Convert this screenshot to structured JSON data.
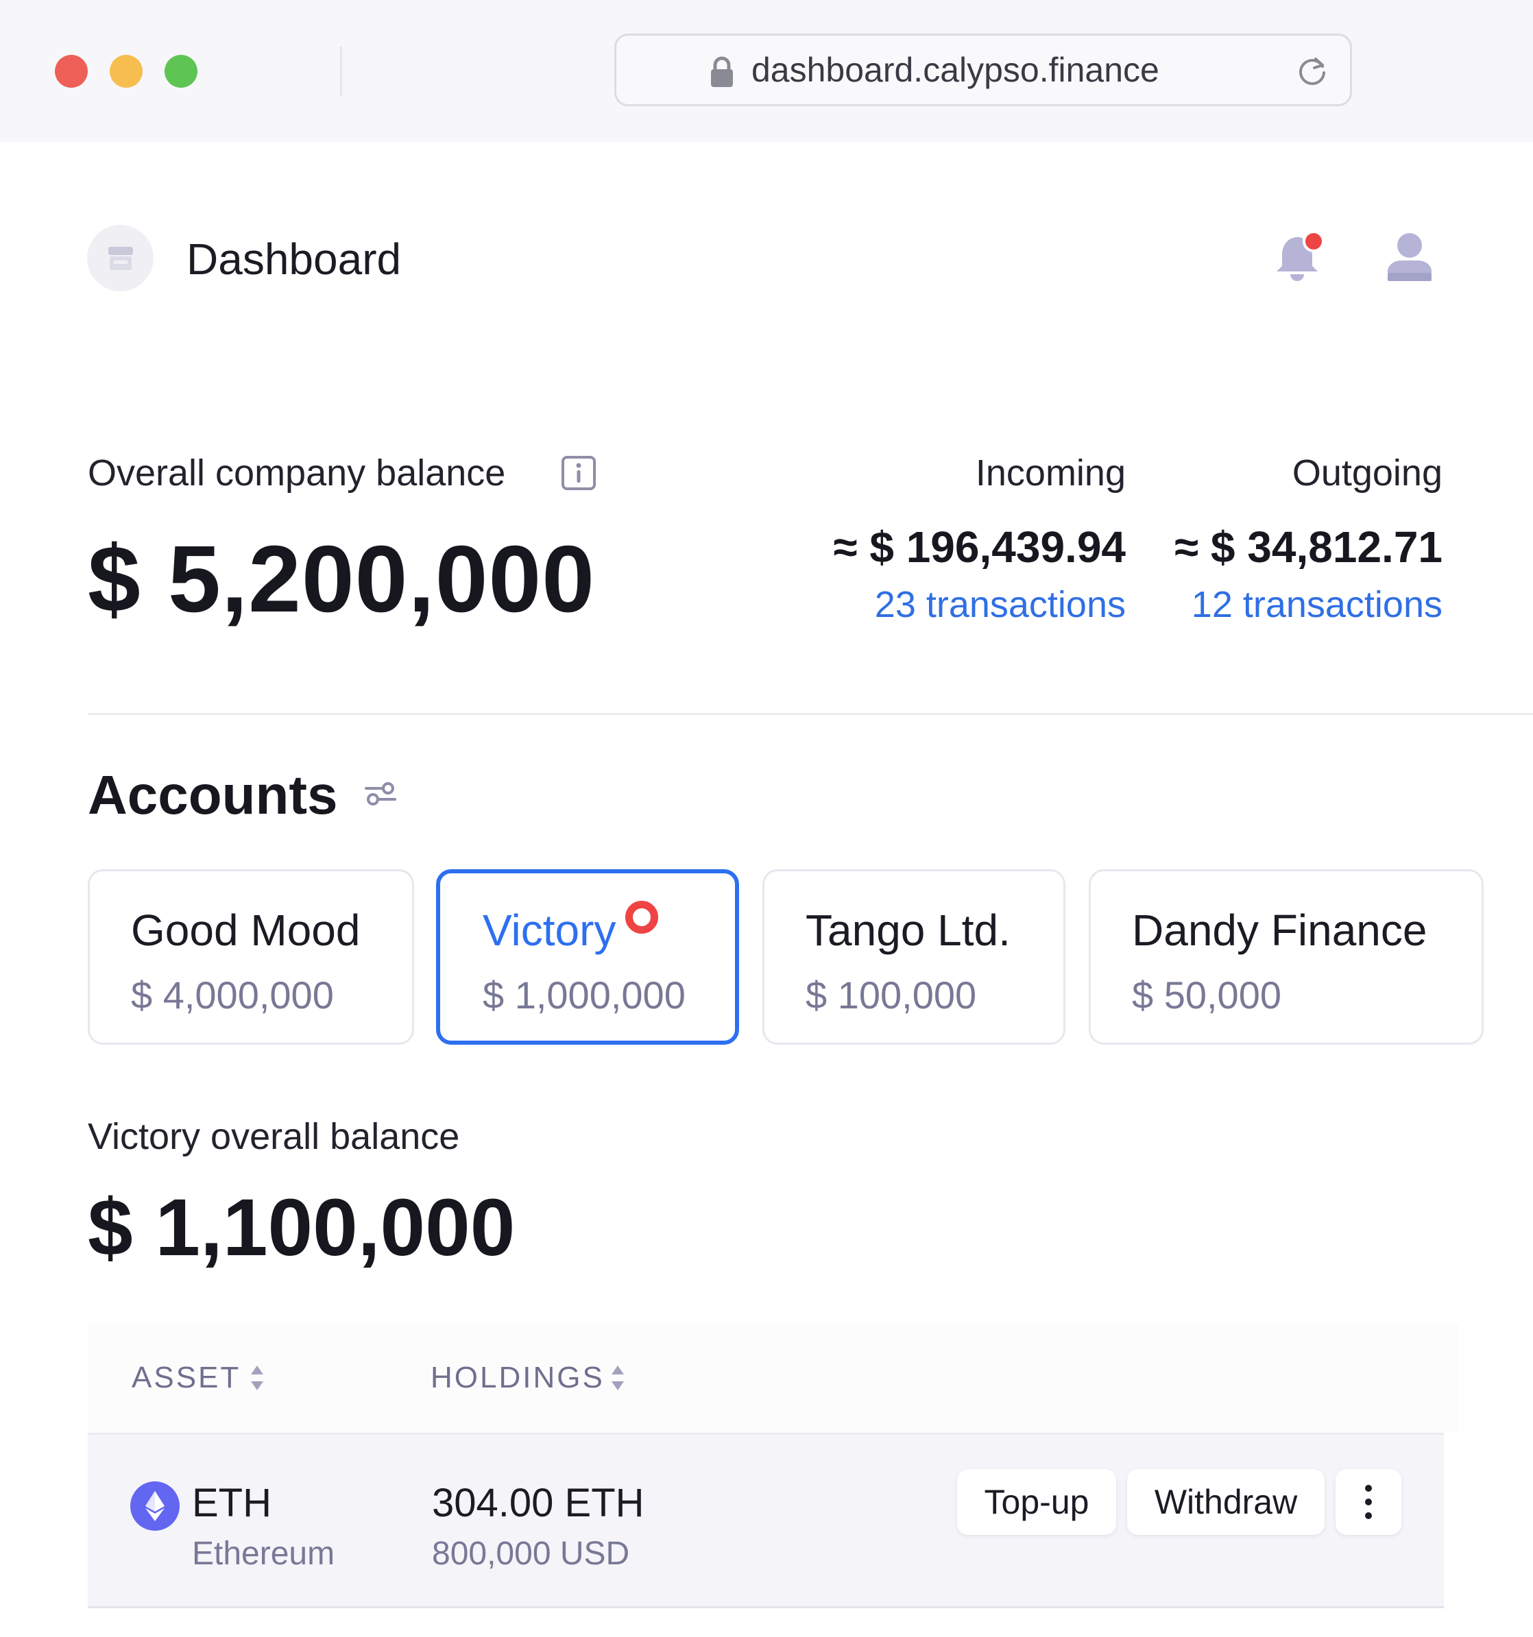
{
  "browser": {
    "url": "dashboard.calypso.finance",
    "traffic_lights": [
      "#ee5f57",
      "#f5be4f",
      "#5ec454"
    ]
  },
  "header": {
    "title": "Dashboard",
    "notification_dot_color": "#ef4444"
  },
  "summary": {
    "overall_label": "Overall company balance",
    "overall_amount": "$ 5,200,000",
    "incoming": {
      "label": "Incoming",
      "amount": "≈ $ 196,439.94",
      "transactions": "23 transactions"
    },
    "outgoing": {
      "label": "Outgoing",
      "amount": "≈ $ 34,812.71",
      "transactions": "12 transactions"
    }
  },
  "accounts": {
    "title": "Accounts",
    "items": [
      {
        "name": "Good Mood",
        "amount": "$ 4,000,000",
        "selected": false
      },
      {
        "name": "Victory",
        "amount": "$ 1,000,000",
        "selected": true,
        "has_alert": true
      },
      {
        "name": "Tango Ltd.",
        "amount": "$ 100,000",
        "selected": false
      },
      {
        "name": "Dandy Finance",
        "amount": "$ 50,000",
        "selected": false
      }
    ]
  },
  "selected_account": {
    "label": "Victory overall balance",
    "amount": "$ 1,100,000"
  },
  "table": {
    "columns": [
      "ASSET",
      "HOLDINGS"
    ],
    "rows": [
      {
        "symbol": "ETH",
        "name": "Ethereum",
        "holdings": "304.00 ETH",
        "holdings_usd": "800,000 USD",
        "actions": [
          "Top-up",
          "Withdraw"
        ]
      }
    ]
  },
  "colors": {
    "accent": "#2d6ff0",
    "link": "#2f6fe4",
    "alert": "#ef4444",
    "eth": "#6366f1"
  }
}
